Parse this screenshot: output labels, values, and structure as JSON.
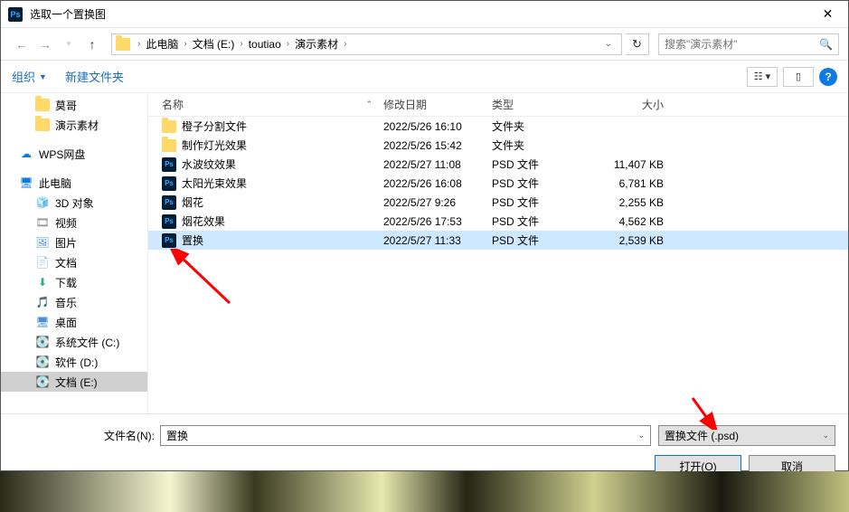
{
  "title": "选取一个置换图",
  "breadcrumb": {
    "items": [
      "此电脑",
      "文档 (E:)",
      "toutiao",
      "演示素材"
    ]
  },
  "search": {
    "placeholder": "搜索\"演示素材\""
  },
  "toolbar": {
    "organize": "组织",
    "newfolder": "新建文件夹"
  },
  "columns": {
    "name": "名称",
    "date": "修改日期",
    "type": "类型",
    "size": "大小"
  },
  "sidebar": {
    "quick": [
      {
        "label": "莫哥",
        "icon": "folder"
      },
      {
        "label": "演示素材",
        "icon": "folder"
      }
    ],
    "wps": {
      "label": "WPS网盘"
    },
    "thispc": {
      "label": "此电脑"
    },
    "pcitems": [
      {
        "label": "3D 对象"
      },
      {
        "label": "视频"
      },
      {
        "label": "图片"
      },
      {
        "label": "文档"
      },
      {
        "label": "下载"
      },
      {
        "label": "音乐"
      },
      {
        "label": "桌面"
      },
      {
        "label": "系统文件 (C:)"
      },
      {
        "label": "软件 (D:)"
      },
      {
        "label": "文档 (E:)",
        "selected": true
      }
    ]
  },
  "files": [
    {
      "name": "橙子分割文件",
      "date": "2022/5/26 16:10",
      "type": "文件夹",
      "size": "",
      "icon": "folder"
    },
    {
      "name": "制作灯光效果",
      "date": "2022/5/26 15:42",
      "type": "文件夹",
      "size": "",
      "icon": "folder"
    },
    {
      "name": "水波纹效果",
      "date": "2022/5/27 11:08",
      "type": "PSD 文件",
      "size": "11,407 KB",
      "icon": "psd"
    },
    {
      "name": "太阳光束效果",
      "date": "2022/5/26 16:08",
      "type": "PSD 文件",
      "size": "6,781 KB",
      "icon": "psd"
    },
    {
      "name": "烟花",
      "date": "2022/5/27 9:26",
      "type": "PSD 文件",
      "size": "2,255 KB",
      "icon": "psd"
    },
    {
      "name": "烟花效果",
      "date": "2022/5/26 17:53",
      "type": "PSD 文件",
      "size": "4,562 KB",
      "icon": "psd"
    },
    {
      "name": "置换",
      "date": "2022/5/27 11:33",
      "type": "PSD 文件",
      "size": "2,539 KB",
      "icon": "psd",
      "selected": true
    }
  ],
  "filename": {
    "label": "文件名(N):",
    "value": "置换"
  },
  "filetype": {
    "value": "置换文件 (.psd)"
  },
  "buttons": {
    "open": "打开(O)",
    "cancel": "取消"
  },
  "icons": {
    "wps": "☁",
    "pc": "🖥",
    "obj3d": "🧊",
    "video": "🎞",
    "pic": "🖼",
    "doc": "📄",
    "dl": "⬇",
    "music": "🎵",
    "desk": "🖥",
    "drive": "💽"
  }
}
